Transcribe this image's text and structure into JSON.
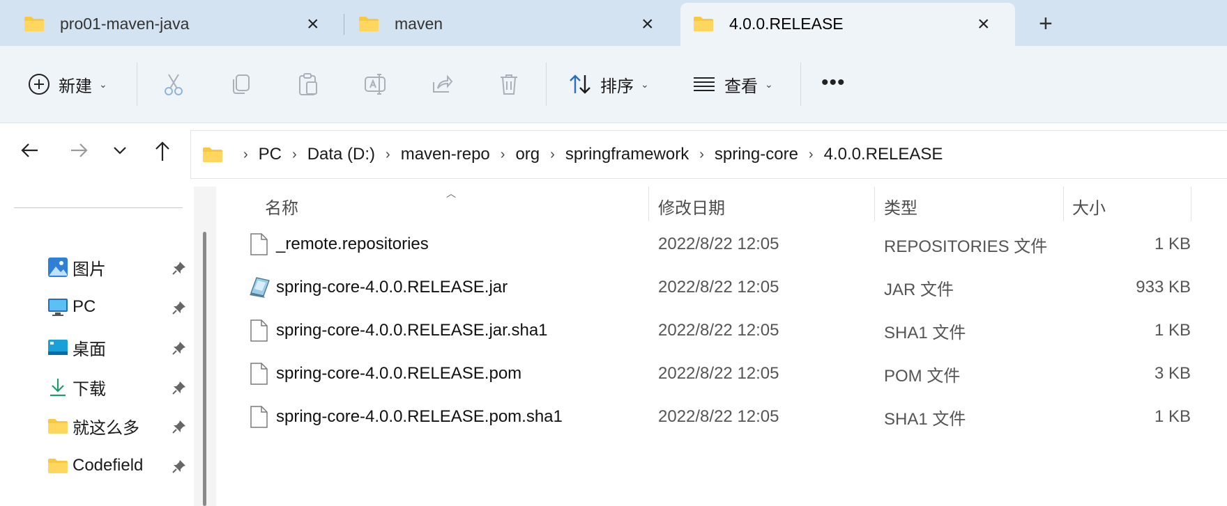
{
  "tabs": [
    {
      "label": "pro01-maven-java"
    },
    {
      "label": "maven"
    },
    {
      "label": "4.0.0.RELEASE"
    }
  ],
  "toolbar": {
    "new_label": "新建",
    "sort_label": "排序",
    "view_label": "查看"
  },
  "breadcrumb": [
    "PC",
    "Data (D:)",
    "maven-repo",
    "org",
    "springframework",
    "spring-core",
    "4.0.0.RELEASE"
  ],
  "sidebar": {
    "items": [
      {
        "label": "图片",
        "icon": "pictures-icon"
      },
      {
        "label": "PC",
        "icon": "monitor-icon"
      },
      {
        "label": "桌面",
        "icon": "desktop-icon"
      },
      {
        "label": "下载",
        "icon": "download-icon"
      },
      {
        "label": "就这么多",
        "icon": "folder-icon"
      },
      {
        "label": "Codefield",
        "icon": "folder-icon"
      }
    ]
  },
  "columns": {
    "name": "名称",
    "date": "修改日期",
    "type": "类型",
    "size": "大小"
  },
  "files": [
    {
      "name": "_remote.repositories",
      "date": "2022/8/22 12:05",
      "type": "REPOSITORIES 文件",
      "size": "1 KB",
      "icon": "file-icon"
    },
    {
      "name": "spring-core-4.0.0.RELEASE.jar",
      "date": "2022/8/22 12:05",
      "type": "JAR 文件",
      "size": "933 KB",
      "icon": "jar-icon"
    },
    {
      "name": "spring-core-4.0.0.RELEASE.jar.sha1",
      "date": "2022/8/22 12:05",
      "type": "SHA1 文件",
      "size": "1 KB",
      "icon": "file-icon"
    },
    {
      "name": "spring-core-4.0.0.RELEASE.pom",
      "date": "2022/8/22 12:05",
      "type": "POM 文件",
      "size": "3 KB",
      "icon": "file-icon"
    },
    {
      "name": "spring-core-4.0.0.RELEASE.pom.sha1",
      "date": "2022/8/22 12:05",
      "type": "SHA1 文件",
      "size": "1 KB",
      "icon": "file-icon"
    }
  ],
  "colors": {
    "tabbar_bg": "#d3e3f1",
    "toolbar_bg": "#eff4f9",
    "folder_yellow": "#f8c93e",
    "accent_blue": "#2a6fb5"
  }
}
